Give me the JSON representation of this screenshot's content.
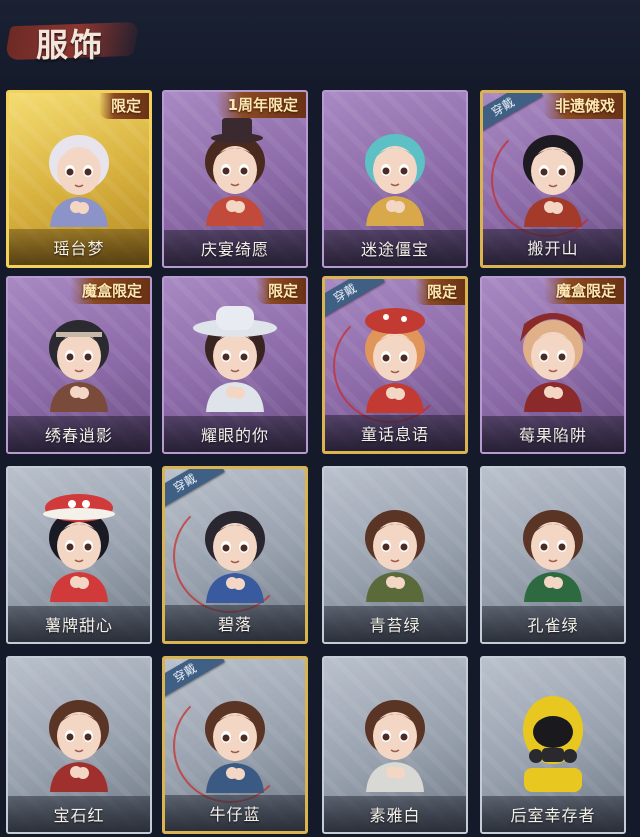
{
  "header": {
    "title": "服饰"
  },
  "cards": [
    {
      "name": "瑶台梦",
      "badge": "限定",
      "equipped": false,
      "frame": "gold",
      "hair": "#e8e4ee",
      "accent": "#8c93c8",
      "hat": "none"
    },
    {
      "name": "庆宴绮愿",
      "badge": "1周年限定",
      "equipped": false,
      "frame": "purple",
      "hair": "#4a2a1e",
      "accent": "#c24a3a",
      "hat": "tophat"
    },
    {
      "name": "迷途僵宝",
      "badge": "",
      "equipped": false,
      "frame": "purple",
      "hair": "#5cc0c4",
      "accent": "#d8a84a",
      "hat": "none"
    },
    {
      "name": "搬开山",
      "badge": "非遗傩戏",
      "equipped": true,
      "frame": "purple",
      "hair": "#1e1a22",
      "accent": "#a33a2a",
      "hat": "none"
    },
    {
      "name": "绣春逍影",
      "badge": "魔盒限定",
      "equipped": false,
      "frame": "purple",
      "hair": "#2a2a30",
      "accent": "#7a4a3a",
      "hat": "band"
    },
    {
      "name": "耀眼的你",
      "badge": "限定",
      "equipped": false,
      "frame": "purple",
      "hair": "#3a2420",
      "accent": "#dfe3ea",
      "hat": "cowboy"
    },
    {
      "name": "童话息语",
      "badge": "限定",
      "equipped": true,
      "frame": "purple",
      "hair": "#e0955a",
      "accent": "#c23a32",
      "hat": "beret"
    },
    {
      "name": "莓果陷阱",
      "badge": "魔盒限定",
      "equipped": false,
      "frame": "purple",
      "hair": "#e0b088",
      "accent": "#8a2a2a",
      "hat": "hood"
    },
    {
      "name": "薯牌甜心",
      "badge": "",
      "equipped": false,
      "frame": "grey",
      "hair": "#1a1a24",
      "accent": "#d03a3a",
      "hat": "fry"
    },
    {
      "name": "碧落",
      "badge": "",
      "equipped": true,
      "frame": "grey",
      "hair": "#2a2630",
      "accent": "#3a5aa0",
      "hat": "none"
    },
    {
      "name": "青苔绿",
      "badge": "",
      "equipped": false,
      "frame": "grey",
      "hair": "#5a3526",
      "accent": "#5a6a3a",
      "hat": "none"
    },
    {
      "name": "孔雀绿",
      "badge": "",
      "equipped": false,
      "frame": "grey",
      "hair": "#5a3526",
      "accent": "#2e6a40",
      "hat": "none"
    },
    {
      "name": "宝石红",
      "badge": "",
      "equipped": false,
      "frame": "grey",
      "hair": "#5a3526",
      "accent": "#a0302e",
      "hat": "none"
    },
    {
      "name": "牛仔蓝",
      "badge": "",
      "equipped": true,
      "frame": "grey",
      "hair": "#5a3526",
      "accent": "#3a5a84",
      "hat": "none"
    },
    {
      "name": "素雅白",
      "badge": "",
      "equipped": false,
      "frame": "grey",
      "hair": "#5a3526",
      "accent": "#d8d8d4",
      "hat": "none"
    },
    {
      "name": "后室幸存者",
      "badge": "",
      "equipped": false,
      "frame": "grey",
      "hair": "#e0c020",
      "accent": "#e8c820",
      "hat": "hazmat"
    }
  ],
  "labels": {
    "equipped": "穿戴"
  }
}
